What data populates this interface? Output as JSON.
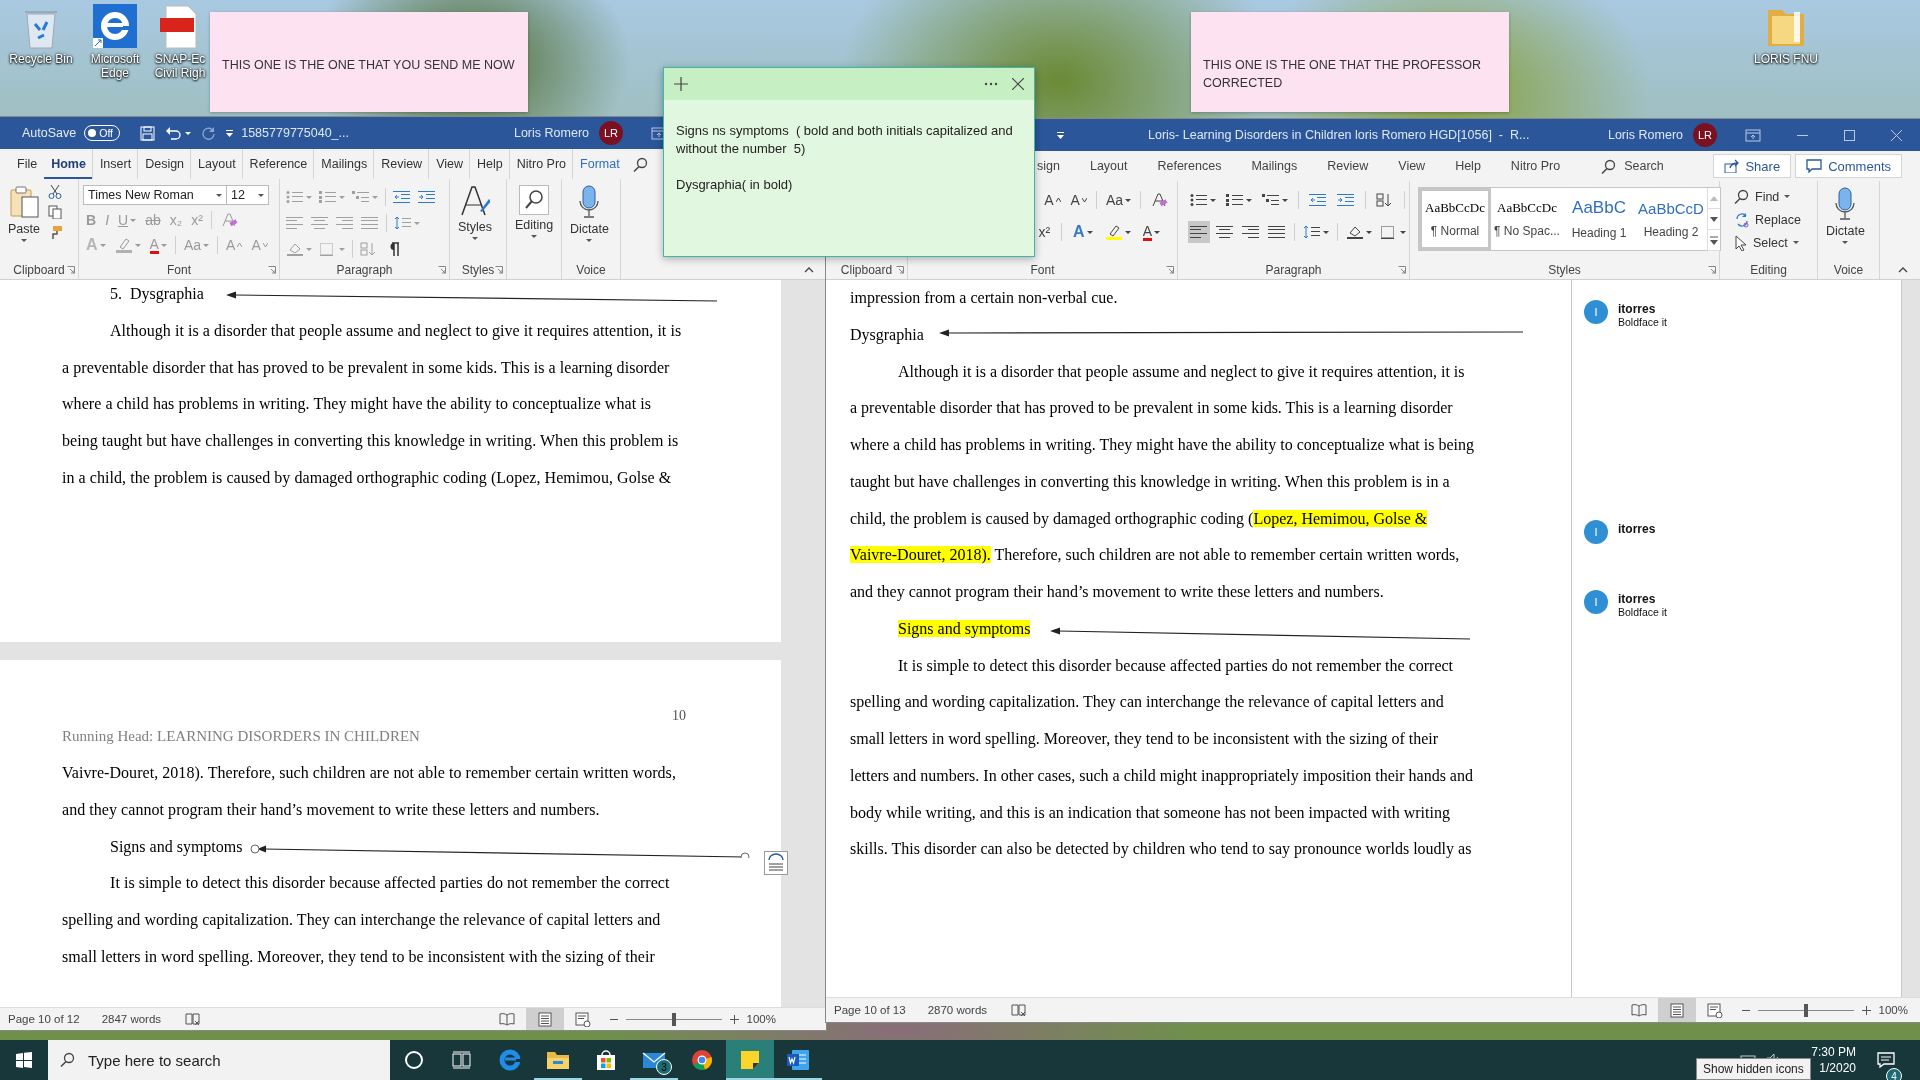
{
  "desktop_icons": [
    {
      "kind": "bin",
      "label": "Recycle Bin"
    },
    {
      "kind": "edge",
      "label": "Microsoft Edge"
    },
    {
      "kind": "pdf",
      "label": "SNAP-Ec Civil Righ"
    },
    {
      "kind": "folder",
      "label": "LORIS FNU"
    }
  ],
  "sticky_notes": [
    {
      "text": "THIS ONE IS THE ONE THAT YOU SEND ME NOW"
    },
    {
      "text": "THIS ONE IS THE ONE THAT THE PROFESSOR CORRECTED"
    }
  ],
  "left_window": {
    "autosave": {
      "label": "AutoSave",
      "toggle_text": "Off",
      "on": false
    },
    "title": "1585779775040_...",
    "user": "Loris Romero",
    "initials": "LR",
    "tabs": [
      {
        "label": "File",
        "selected": false,
        "kind": "standard"
      },
      {
        "label": "Home",
        "selected": true,
        "kind": "standard"
      },
      {
        "label": "Insert",
        "selected": false,
        "kind": "standard"
      },
      {
        "label": "Design",
        "selected": false,
        "kind": "standard"
      },
      {
        "label": "Layout",
        "selected": false,
        "kind": "standard"
      },
      {
        "label": "Reference",
        "selected": false,
        "kind": "standard"
      },
      {
        "label": "Mailings",
        "selected": false,
        "kind": "standard"
      },
      {
        "label": "Review",
        "selected": false,
        "kind": "standard"
      },
      {
        "label": "View",
        "selected": false,
        "kind": "standard"
      },
      {
        "label": "Help",
        "selected": false,
        "kind": "standard"
      },
      {
        "label": "Nitro Pro",
        "selected": false,
        "kind": "standard"
      },
      {
        "label": "Format",
        "selected": false,
        "kind": "contextual"
      }
    ],
    "ribbon": {
      "kind": "full",
      "disabled": true,
      "paste": "Paste",
      "font_name": "Times New Roman",
      "font_size": "12",
      "font_row2": [
        {
          "kind": "bold",
          "glyph": "B"
        },
        {
          "kind": "italic",
          "glyph": "I"
        },
        {
          "kind": "underline",
          "glyph": "U"
        },
        {
          "kind": "strike",
          "glyph": "ab"
        },
        {
          "kind": "sub",
          "glyph": "x₂"
        },
        {
          "kind": "sup",
          "glyph": "x²"
        },
        {
          "kind": "clear"
        }
      ],
      "font_row3": [
        {
          "kind": "effects",
          "glyph": "A"
        },
        {
          "kind": "highlight"
        },
        {
          "kind": "color",
          "glyph": "A"
        },
        {
          "kind": "case",
          "glyph": "Aa"
        },
        {
          "kind": "grow",
          "glyph": "A"
        },
        {
          "kind": "shrink",
          "glyph": "A"
        }
      ],
      "styles_button": "Styles",
      "editing_button": "Editing",
      "dictate_button": "Dictate",
      "groups": {
        "clipboard": "Clipboard",
        "font": "Font",
        "paragraph": "Paragraph",
        "styles": "Styles",
        "voice": "Voice"
      }
    },
    "document": {
      "pages": [
        {
          "blocks": [
            {
              "kind": "heading",
              "indent": true,
              "arrow": {
                "selected": false
              },
              "segments": [
                {
                  "text": "5.  Dysgraphia",
                  "highlight": false
                }
              ]
            },
            {
              "kind": "paragraph",
              "indent": true,
              "segments": [
                {
                  "text": "Although it is a disorder that people assume and neglect to give it requires attention, it is a preventable disorder that has proved to be prevalent in some kids. This is a learning disorder where a child has problems in writing. They might have the ability to conceptualize what is being taught but have challenges in converting this knowledge in writing. When this problem is in a child, the problem is caused by damaged orthographic coding (Lopez, Hemimou, Golse &",
                  "highlight": false
                }
              ]
            }
          ]
        },
        {
          "blocks": [
            {
              "kind": "page_number",
              "text": "10"
            },
            {
              "kind": "running_head",
              "text": "Running Head: LEARNING DISORDERS IN CHILDREN"
            },
            {
              "kind": "paragraph",
              "indent": false,
              "segments": [
                {
                  "text": "Vaivre-Douret, 2018). Therefore, such children are not able to remember certain written words, and they cannot program their hand’s movement to write these letters and numbers.",
                  "highlight": false
                }
              ]
            },
            {
              "kind": "heading",
              "indent": true,
              "arrow": {
                "selected": true
              },
              "segments": [
                {
                  "text": "Signs and symptoms",
                  "highlight": false
                }
              ]
            },
            {
              "kind": "paragraph",
              "indent": true,
              "segments": [
                {
                  "text": "It is simple to detect this disorder because affected parties do not remember the correct spelling and wording capitalization. They can interchange the relevance of capital letters and small letters in word spelling. Moreover, they tend to be inconsistent with the sizing of their",
                  "highlight": false
                }
              ]
            }
          ]
        }
      ]
    },
    "status_bar": {
      "page": "Page 10 of 12",
      "words": "2847 words",
      "views": [
        {
          "selected": false
        },
        {
          "selected": true
        },
        {
          "selected": false
        }
      ],
      "zoom_slider": {
        "level": 0.5
      },
      "zoom": "100%"
    }
  },
  "right_window": {
    "title": "Loris- Learning Disorders in Children loris Romero HGD[1056]  -  R...",
    "user": "Loris Romero",
    "initials": "LR",
    "tabs": [
      {
        "label": "sign",
        "selected": false,
        "kind": "standard"
      },
      {
        "label": "Layout",
        "selected": false,
        "kind": "standard"
      },
      {
        "label": "References",
        "selected": false,
        "kind": "standard"
      },
      {
        "label": "Mailings",
        "selected": false,
        "kind": "standard"
      },
      {
        "label": "Review",
        "selected": false,
        "kind": "standard"
      },
      {
        "label": "View",
        "selected": false,
        "kind": "standard"
      },
      {
        "label": "Help",
        "selected": false,
        "kind": "standard"
      },
      {
        "label": "Nitro Pro",
        "selected": false,
        "kind": "standard"
      }
    ],
    "search_label": "Search",
    "share": "Share",
    "comments_button": "Comments",
    "ribbon": {
      "kind": "scrolled",
      "disabled": false,
      "font_row1": [
        {
          "kind": "grow",
          "glyph": "A"
        },
        {
          "kind": "shrink",
          "glyph": "A"
        },
        {
          "kind": "case",
          "glyph": "Aa"
        },
        {
          "kind": "clear"
        }
      ],
      "font_row2": [
        {
          "kind": "sup",
          "glyph": "x²"
        },
        {
          "kind": "effects",
          "glyph": "A"
        },
        {
          "kind": "highlight"
        },
        {
          "kind": "color",
          "glyph": "A"
        }
      ],
      "align_buttons": [
        {
          "kind": "left",
          "selected": true
        },
        {
          "kind": "center",
          "selected": false
        },
        {
          "kind": "right",
          "selected": false
        },
        {
          "kind": "justify",
          "selected": false
        }
      ],
      "styles": [
        {
          "kind": "normal",
          "preview": "AaBbCcDc",
          "label": "¶ Normal",
          "selected": true
        },
        {
          "kind": "no_spacing",
          "preview": "AaBbCcDc",
          "label": "¶ No Spac...",
          "selected": false
        },
        {
          "kind": "heading1",
          "preview": "AaBbC",
          "label": "Heading 1",
          "selected": false
        },
        {
          "kind": "heading2",
          "preview": "AaBbCcD",
          "label": "Heading 2",
          "selected": false
        }
      ],
      "editing": [
        {
          "kind": "find",
          "label": "Find"
        },
        {
          "kind": "replace",
          "label": "Replace"
        },
        {
          "kind": "select",
          "label": "Select"
        }
      ],
      "dictate_button": "Dictate",
      "groups": {
        "clipboard": "Clipboard",
        "font": "Font",
        "paragraph": "Paragraph",
        "styles": "Styles",
        "editing": "Editing",
        "voice": "Voice"
      }
    },
    "document": {
      "pages": [
        {
          "blocks": [
            {
              "kind": "paragraph",
              "indent": false,
              "segments": [
                {
                  "text": "impression from a certain non-verbal cue.",
                  "highlight": false
                }
              ]
            },
            {
              "kind": "heading",
              "indent": false,
              "arrow": {
                "selected": false
              },
              "segments": [
                {
                  "text": "Dysgraphia",
                  "highlight": false
                }
              ]
            },
            {
              "kind": "paragraph",
              "indent": true,
              "segments": [
                {
                  "text": "Although it is a disorder that people assume and neglect to give it requires attention, it is a preventable disorder that has proved to be prevalent in some kids. This is a learning disorder where a child has problems in writing. They might have the ability to conceptualize what is being taught but have challenges in converting this knowledge in writing. When this problem is in a child, the problem is caused by damaged orthographic coding (",
                  "highlight": false
                },
                {
                  "text": "Lopez, Hemimou, Golse & Vaivre-Douret, 2018).",
                  "highlight": true
                },
                {
                  "text": " Therefore, such children are not able to remember certain written words, and they cannot program their hand’s movement to write these letters and numbers.",
                  "highlight": false
                }
              ]
            },
            {
              "kind": "heading",
              "indent": true,
              "arrow": {
                "selected": false
              },
              "segments": [
                {
                  "text": "Signs and symptoms",
                  "highlight": true
                }
              ]
            },
            {
              "kind": "paragraph",
              "indent": true,
              "segments": [
                {
                  "text": "It is simple to detect this disorder because affected parties do not remember the correct spelling and wording capitalization. They can interchange the relevance of capital letters and small letters in word spelling. Moreover, they tend to be inconsistent with the sizing of their letters and numbers. In other cases, such a child might inappropriately imposition their hands and body while writing, and this is an indication that someone has not been impacted with writing skills. This disorder can also be detected by children who tend to say pronounce worlds loudly as",
                  "highlight": false
                }
              ]
            }
          ]
        }
      ],
      "comments": [
        {
          "initial": "I",
          "author": "itorres",
          "text": "Boldface it"
        },
        {
          "initial": "I",
          "author": "itorres"
        },
        {
          "initial": "I",
          "author": "itorres",
          "text": "Boldface it"
        }
      ]
    },
    "status_bar": {
      "page": "Page 10 of 13",
      "words": "2870 words",
      "views": [
        {
          "selected": false
        },
        {
          "selected": true
        },
        {
          "selected": false
        }
      ],
      "zoom_slider": {
        "level": 0.5
      },
      "zoom": "100%"
    }
  },
  "open_note": {
    "paragraphs": [
      "Signs ns symptoms  ( bold and both initials capitalized and without the number  5)",
      "Dysgraphia( in bold)"
    ]
  },
  "taskbar": {
    "search_placeholder": "Type here to search",
    "apps": [
      {
        "kind": "cortana",
        "running": false,
        "selected": false
      },
      {
        "kind": "taskview",
        "running": false,
        "selected": false
      },
      {
        "kind": "edge",
        "running": false,
        "selected": false
      },
      {
        "kind": "explorer",
        "running": true,
        "selected": false
      },
      {
        "kind": "store",
        "running": false,
        "selected": false
      },
      {
        "kind": "mail",
        "running": true,
        "selected": false,
        "badge": "3"
      },
      {
        "kind": "chrome",
        "running": false,
        "selected": false
      },
      {
        "kind": "sticky",
        "running": true,
        "selected": true
      },
      {
        "kind": "word",
        "running": true,
        "selected": false
      }
    ],
    "tooltip": "Show hidden icons",
    "time": "7:30 PM",
    "date": "1/2020",
    "notifications": "4"
  }
}
